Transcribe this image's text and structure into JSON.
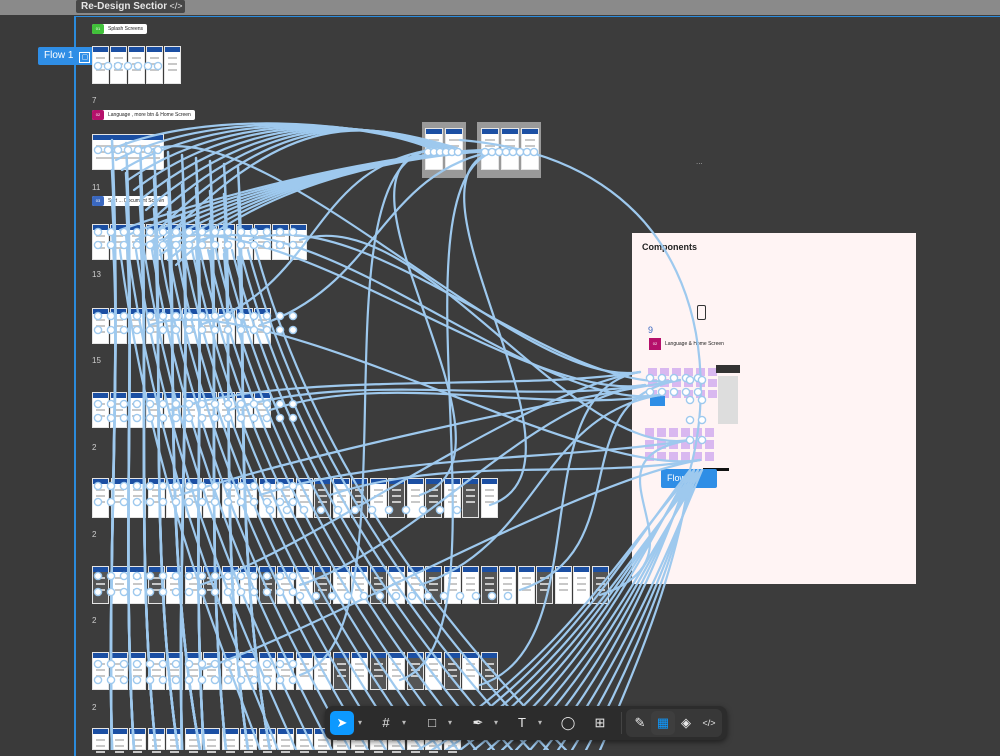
{
  "section": {
    "title": "Re-Design Section",
    "code_icon": "</>"
  },
  "flow_chip": {
    "label": "Flow 1",
    "icon": "frame-icon"
  },
  "tags": [
    {
      "num": "01",
      "label": "Splash Screens",
      "color": "#41c13a"
    },
    {
      "num": "02",
      "label": "Language , more btn & Home Screen",
      "color": "#b5106b"
    },
    {
      "num": "03",
      "label": "Sort ... Document Screen",
      "color": "#3a68c0"
    }
  ],
  "row_numbers": [
    "7",
    "11",
    "13",
    "15",
    "2",
    "2",
    "2",
    "2"
  ],
  "components": {
    "title": "Components",
    "number": "9",
    "tag_num": "02",
    "tag_label": "Language & Home Screen",
    "flow_button": "Flow"
  },
  "ellipsis": "...",
  "colors": {
    "canvas": "#3c3c3c",
    "accent": "#0d99ff",
    "wire": "#9ec9ee",
    "component_bg": "#fff4f4"
  },
  "toolbar": {
    "tools": [
      {
        "name": "move-tool-button",
        "glyph": "➤",
        "active": true
      },
      {
        "name": "frame-tool-button",
        "glyph": "#",
        "active": false
      },
      {
        "name": "shape-tool-button",
        "glyph": "□",
        "active": false
      },
      {
        "name": "pen-tool-button",
        "glyph": "✒",
        "active": false
      },
      {
        "name": "text-tool-button",
        "glyph": "T",
        "active": false
      },
      {
        "name": "comment-tool-button",
        "glyph": "◯",
        "active": false
      },
      {
        "name": "actions-button",
        "glyph": "⊞",
        "active": false
      }
    ],
    "modes": [
      {
        "name": "draw-mode-button",
        "glyph": "✎"
      },
      {
        "name": "design-mode-button",
        "glyph": "▦"
      },
      {
        "name": "prototype-mode-button",
        "glyph": "◈"
      },
      {
        "name": "dev-mode-button",
        "glyph": "</>"
      }
    ]
  }
}
